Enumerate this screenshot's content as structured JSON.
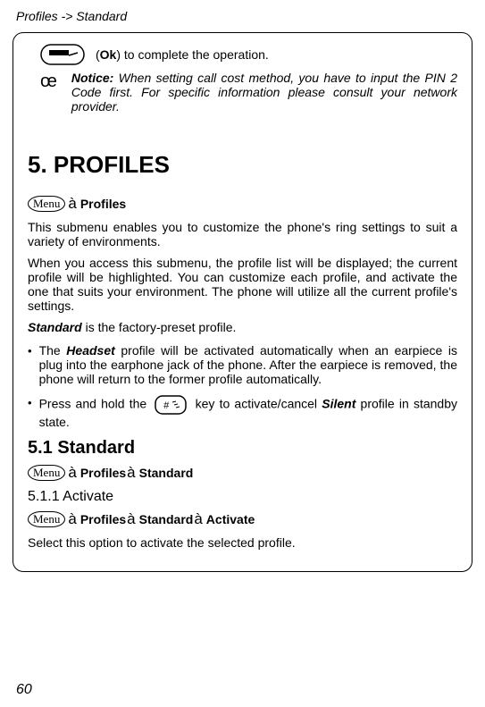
{
  "header": "Profiles -> Standard",
  "ok_line": {
    "prefix": "(",
    "ok": "Ok",
    "suffix": ") to complete the operation."
  },
  "notice_mark": "œ",
  "notice": {
    "label": "Notice:",
    "text": " When setting call cost method, you have to input the PIN 2 Code first. For specific information please consult your network provider."
  },
  "section_title": "5. PROFILES",
  "menu_glyph": "Menu",
  "arrow_glyph": "à",
  "menu1_label": "Profiles",
  "para1": "This submenu enables you to customize the phone's ring settings to suit a variety of environments.",
  "para2": "When you access this submenu, the profile list will be displayed; the current profile will be highlighted. You can customize each profile, and activate the one that suits your environment. The phone will utilize all the current profile's settings.",
  "standard_line_bold": "Standard",
  "standard_line_rest": " is the factory-preset profile.",
  "bullet1_a": "The ",
  "bullet1_bold": "Headset",
  "bullet1_b": " profile will be activated automatically when an earpiece is plug into the earphone jack of the phone. After the earpiece is removed, the phone will return to the former profile automatically.",
  "bullet2_a": "Press and hold the ",
  "bullet2_b": " key to activate/cancel ",
  "bullet2_bold": "Silent",
  "bullet2_c": " profile in standby state.",
  "subsection_title": "5.1 Standard",
  "menu2_labels": {
    "a": "Profiles",
    "b": "Standard"
  },
  "subsub_title": "5.1.1 Activate",
  "menu3_labels": {
    "a": "Profiles",
    "b": "Standard",
    "c": "Activate"
  },
  "para3": "Select this option to activate the selected profile.",
  "page_number": "60"
}
